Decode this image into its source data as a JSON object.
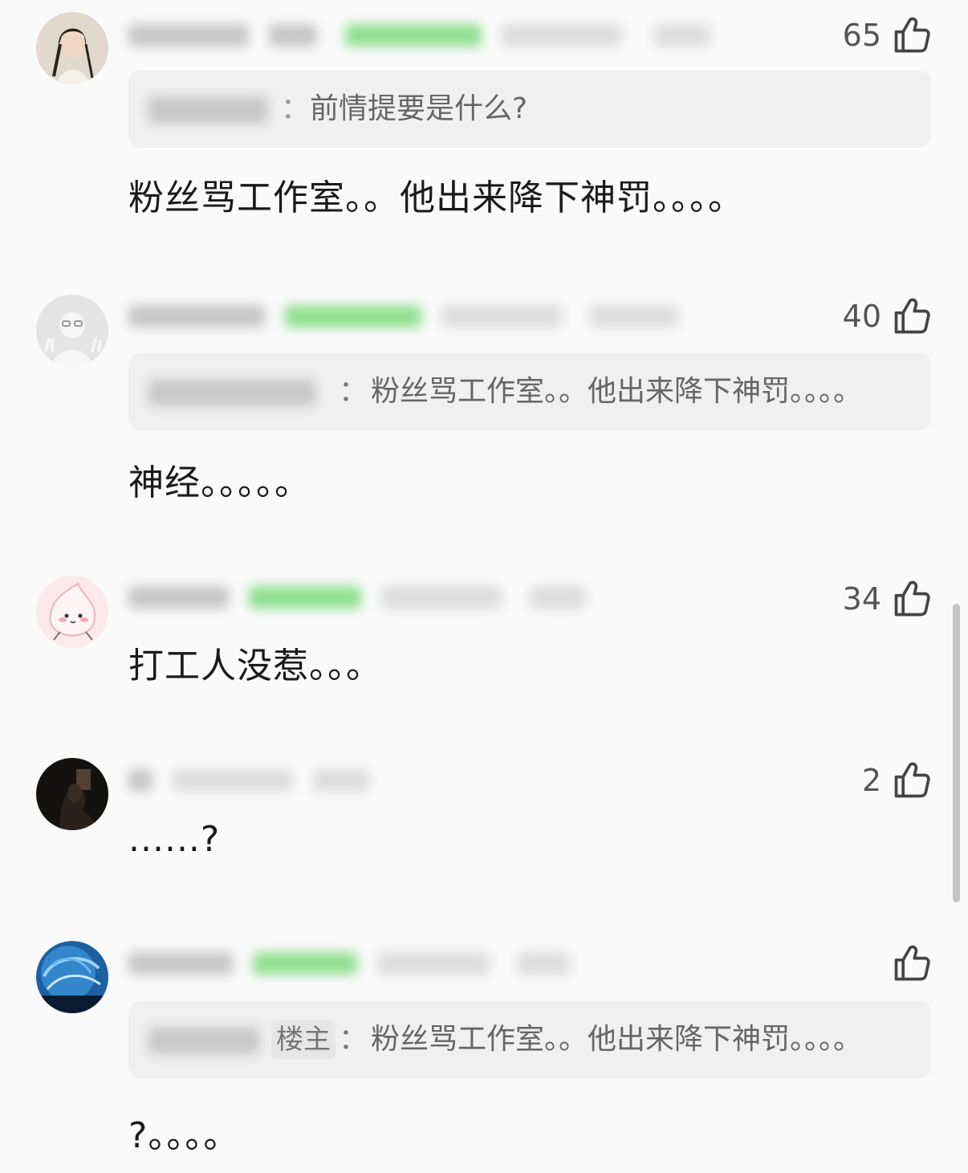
{
  "comments": [
    {
      "likes": "65",
      "reply": {
        "separator": "：",
        "text": "前情提要是什么?"
      },
      "body": "粉丝骂工作室。。他出来降下神罚。。。。"
    },
    {
      "likes": "40",
      "reply": {
        "separator": "：",
        "text": "粉丝骂工作室。。他出来降下神罚。。。。"
      },
      "body": "神经。。。。。"
    },
    {
      "likes": "34",
      "body": "打工人没惹。。。"
    },
    {
      "likes": "2",
      "body": "......?"
    },
    {
      "likes": "",
      "reply": {
        "owner_tag": "楼主",
        "separator": "：",
        "text": "粉丝骂工作室。。他出来降下神罚。。。。"
      },
      "body": "?。。。。"
    }
  ],
  "icons": {
    "like": "thumbs-up-icon"
  },
  "colors": {
    "badge_green": "#8fe08f",
    "text_muted": "#666666",
    "quote_bg": "#f0f0f0"
  }
}
